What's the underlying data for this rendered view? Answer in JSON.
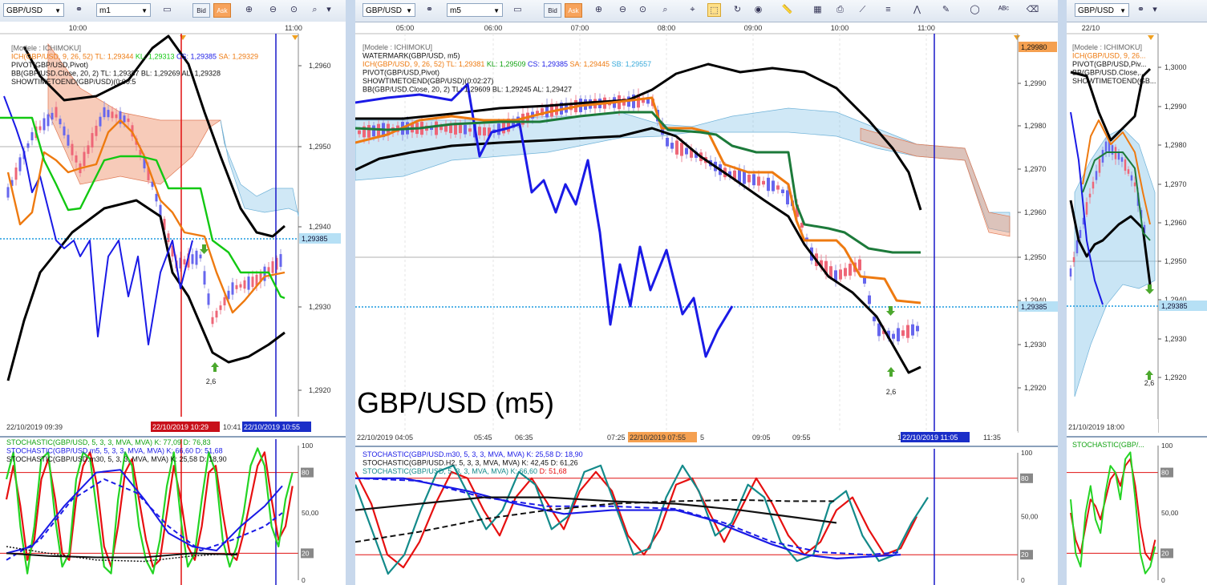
{
  "colors": {
    "ich": "#ee7a10",
    "kl": "#12c812",
    "cs": "#1a1ae6",
    "sa": "#ee7a10",
    "sb": "#37a9da",
    "bb": "#000000",
    "up": "#6666ee",
    "down": "#ee6677",
    "price": "#1b9adf"
  },
  "toolbar": {
    "symbols": [
      "GBP/USD",
      "GBP/USD",
      "GBP/USD"
    ],
    "timeframes": [
      "m1",
      "m5"
    ],
    "bid": "Bid",
    "ask": "Ask"
  },
  "panels": [
    {
      "id": "left",
      "time_ticks": [
        "10:00",
        "11:00"
      ],
      "bottom_labels": [
        "22/10/2019 09:39",
        "22/10/2019 10:29",
        "10:41",
        "22/10/2019 10:55"
      ],
      "price_ticks": [
        "1,2960",
        "1,2950",
        "1,2940",
        "1,2930",
        "1,2920"
      ],
      "current_price": "1,29385",
      "arrow_label": "2,6",
      "legend": [
        {
          "text": "[Modele : ICHIMOKU]",
          "color": "#666666"
        },
        {
          "parts": [
            {
              "text": "ICH(GBP/USD, 9, 26, 52)  TL: 1,29344",
              "color": "#ee7a10"
            },
            {
              "text": "  KL: 1,29313",
              "color": "#12c812"
            },
            {
              "text": "  CS: 1,29385",
              "color": "#1a1ae6"
            },
            {
              "text": "  SA: 1,29329",
              "color": "#ee7a10"
            }
          ]
        },
        {
          "text": "PIVOT(GBP/USD,Pivot)",
          "color": "#111111"
        },
        {
          "text": "BB(GBP/USD.Close, 20, 2)  TL: 1,29387  BL: 1,29269  AL: 1,29328",
          "color": "#111111"
        },
        {
          "text": "SHOWTIMETOEND(GBP/USD)(0:00:5",
          "color": "#111111"
        }
      ],
      "stoch_legend": [
        {
          "text": "STOCHASTIC(GBP/USD, 5, 3, 3, MVA, MVA)  K: 77,09  D: 76,83",
          "color": "#12a312"
        },
        {
          "text": "STOCHASTIC(GBP/USD.m5, 5, 3, 3, MVA, MVA)  K: 66,60  D: 51,68",
          "color": "#1a1ae6"
        },
        {
          "text": "STOCHASTIC(GBP/USD.m30, 5, 3, 3, MVA, MVA)  K: 25,58  D: 18,90",
          "color": "#111111"
        }
      ],
      "stoch_ticks": [
        "100",
        "80",
        "50,00",
        "20",
        "0"
      ]
    },
    {
      "id": "middle",
      "time_ticks": [
        "05:00",
        "06:00",
        "07:00",
        "08:00",
        "09:00",
        "10:00",
        "11:00"
      ],
      "bottom_labels": [
        "22/10/2019 04:05",
        "05:45",
        "06:35",
        "07:25",
        "22/10/2019 07:55",
        "5",
        "09:05",
        "09:55",
        "1",
        "22/10/2019 11:05",
        "11:35"
      ],
      "price_ticks": [
        "1,2990",
        "1,2980",
        "1,2970",
        "1,2960",
        "1,2950",
        "1,2940",
        "1,2930",
        "1,2920"
      ],
      "top_price": "1,29980",
      "current_price": "1,29385",
      "arrow_label": "2,6",
      "watermark": "GBP/USD (m5)",
      "legend": [
        {
          "text": "[Modele : ICHIMOKU]",
          "color": "#666666"
        },
        {
          "text": "WATERMARK(GBP/USD, m5)",
          "color": "#111111"
        },
        {
          "parts": [
            {
              "text": "ICH(GBP/USD, 9, 26, 52)  TL: 1,29381",
              "color": "#ee7a10"
            },
            {
              "text": "  KL: 1,29509",
              "color": "#12a312"
            },
            {
              "text": "  CS: 1,29385",
              "color": "#1a1ae6"
            },
            {
              "text": "  SA: 1,29445",
              "color": "#ee7a10"
            },
            {
              "text": "  SB: 1,29557",
              "color": "#37a9da"
            }
          ]
        },
        {
          "text": "PIVOT(GBP/USD,Pivot)",
          "color": "#111111"
        },
        {
          "text": "SHOWTIMETOEND(GBP/USD)(0:02:27)",
          "color": "#111111"
        },
        {
          "text": "BB(GBP/USD.Close, 20, 2)  TL: 1,29609  BL: 1,29245  AL: 1,29427",
          "color": "#111111"
        }
      ],
      "stoch_legend": [
        {
          "text": "STOCHASTIC(GBP/USD.m30, 5, 3, 3, MVA, MVA)  K: 25,58  D: 18,90",
          "color": "#1a1ae6"
        },
        {
          "text": "STOCHASTIC(GBP/USD.H2, 5, 3, 3, MVA, MVA)  K: 42,45  D: 61,26",
          "color": "#111111"
        },
        {
          "parts": [
            {
              "text": "STOCHASTIC(GBP/USD, 5, 3, 3, MVA, MVA)  K: 66,60",
              "color": "#138a8a"
            },
            {
              "text": "  D: 51,68",
              "color": "#e61010"
            }
          ]
        }
      ],
      "stoch_ticks": [
        "100",
        "80",
        "50,00",
        "20",
        "0"
      ]
    },
    {
      "id": "right",
      "time_ticks": [
        "22/10"
      ],
      "bottom_labels": [
        "21/10/2019 18:00"
      ],
      "price_ticks": [
        "1,3000",
        "1,2990",
        "1,2980",
        "1,2970",
        "1,2960",
        "1,2950",
        "1,2940",
        "1,2930",
        "1,2920"
      ],
      "current_price": "1,29385",
      "arrow_label": "2,6",
      "legend": [
        {
          "text": "[Modele : ICHIMOKU]",
          "color": "#666666"
        },
        {
          "text": "ICH(GBP/USD, 9, 26...",
          "color": "#ee7a10"
        },
        {
          "text": "PIVOT(GBP/USD,Piv...",
          "color": "#111111"
        },
        {
          "text": "BB(GBP/USD.Close,...",
          "color": "#111111"
        },
        {
          "text": "SHOWTIMETOEND(GB...",
          "color": "#111111"
        }
      ],
      "stoch_legend": [
        {
          "text": "STOCHASTIC(GBP/...",
          "color": "#12a312"
        }
      ],
      "stoch_ticks": [
        "100",
        "80",
        "50,00",
        "20",
        "0"
      ]
    }
  ],
  "chart_data": [
    {
      "type": "line",
      "title": "GBP/USD m1",
      "x": [
        "10:00",
        "11:00"
      ],
      "series": [
        {
          "name": "TL",
          "values": [
            1.29344
          ]
        },
        {
          "name": "KL",
          "values": [
            1.29313
          ]
        },
        {
          "name": "CS",
          "values": [
            1.29385
          ]
        },
        {
          "name": "SA",
          "values": [
            1.29329
          ]
        }
      ],
      "ylim": [
        1.2917,
        1.2967
      ]
    },
    {
      "type": "line",
      "title": "GBP/USD (m5)",
      "x": [
        "05:00",
        "06:00",
        "07:00",
        "08:00",
        "09:00",
        "10:00",
        "11:00"
      ],
      "series": [
        {
          "name": "TL",
          "values": [
            1.29381
          ]
        },
        {
          "name": "KL",
          "values": [
            1.29509
          ]
        },
        {
          "name": "CS",
          "values": [
            1.29385
          ]
        },
        {
          "name": "SA",
          "values": [
            1.29445
          ]
        },
        {
          "name": "SB",
          "values": [
            1.29557
          ]
        }
      ],
      "ylim": [
        1.2916,
        1.2998
      ]
    },
    {
      "type": "line",
      "title": "GBP/USD",
      "x": [
        "22/10"
      ],
      "series": [
        {
          "name": "CS",
          "values": [
            1.29385
          ]
        }
      ],
      "ylim": [
        1.2913,
        1.3007
      ]
    }
  ]
}
